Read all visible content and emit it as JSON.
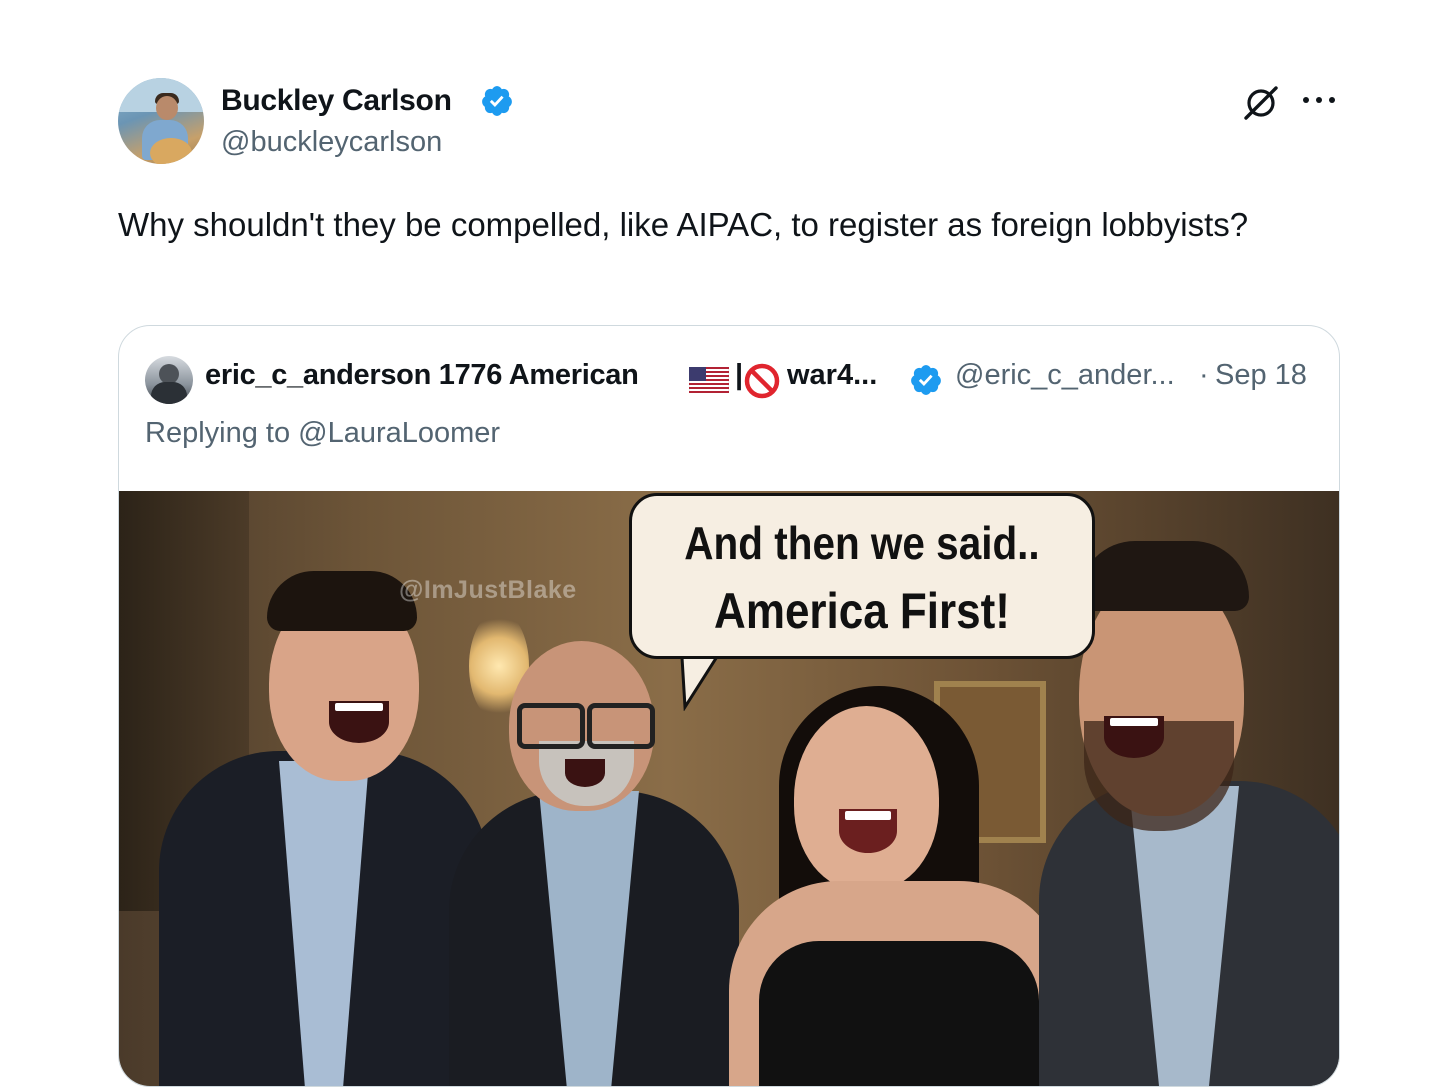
{
  "tweet": {
    "author_name": "Buckley Carlson",
    "author_handle": "@buckleycarlson",
    "text": "Why shouldn't they be compelled, like AIPAC, to register as foreign lobbyists?"
  },
  "quoted_tweet": {
    "author_name": "eric_c_anderson 1776 American",
    "name_separator": "|",
    "name_suffix": "war4...",
    "author_handle": "@eric_c_ander...",
    "separator": "·",
    "date": "Sep 18",
    "replying_prefix": "Replying to",
    "replying_to": "@LauraLoomer",
    "image": {
      "watermark": "@ImJustBlake",
      "speech_line_1": "And then we said..",
      "speech_line_2": "America First!"
    }
  },
  "icons": {
    "verified": "verified-badge-icon",
    "grok": "grok-icon",
    "more": "more-options-icon",
    "flag": "us-flag-icon",
    "no_entry": "prohibited-icon"
  },
  "colors": {
    "verified_blue": "#1d9bf0",
    "secondary_text": "#536471",
    "primary_text": "#0f1419",
    "border": "#cfd9de"
  }
}
